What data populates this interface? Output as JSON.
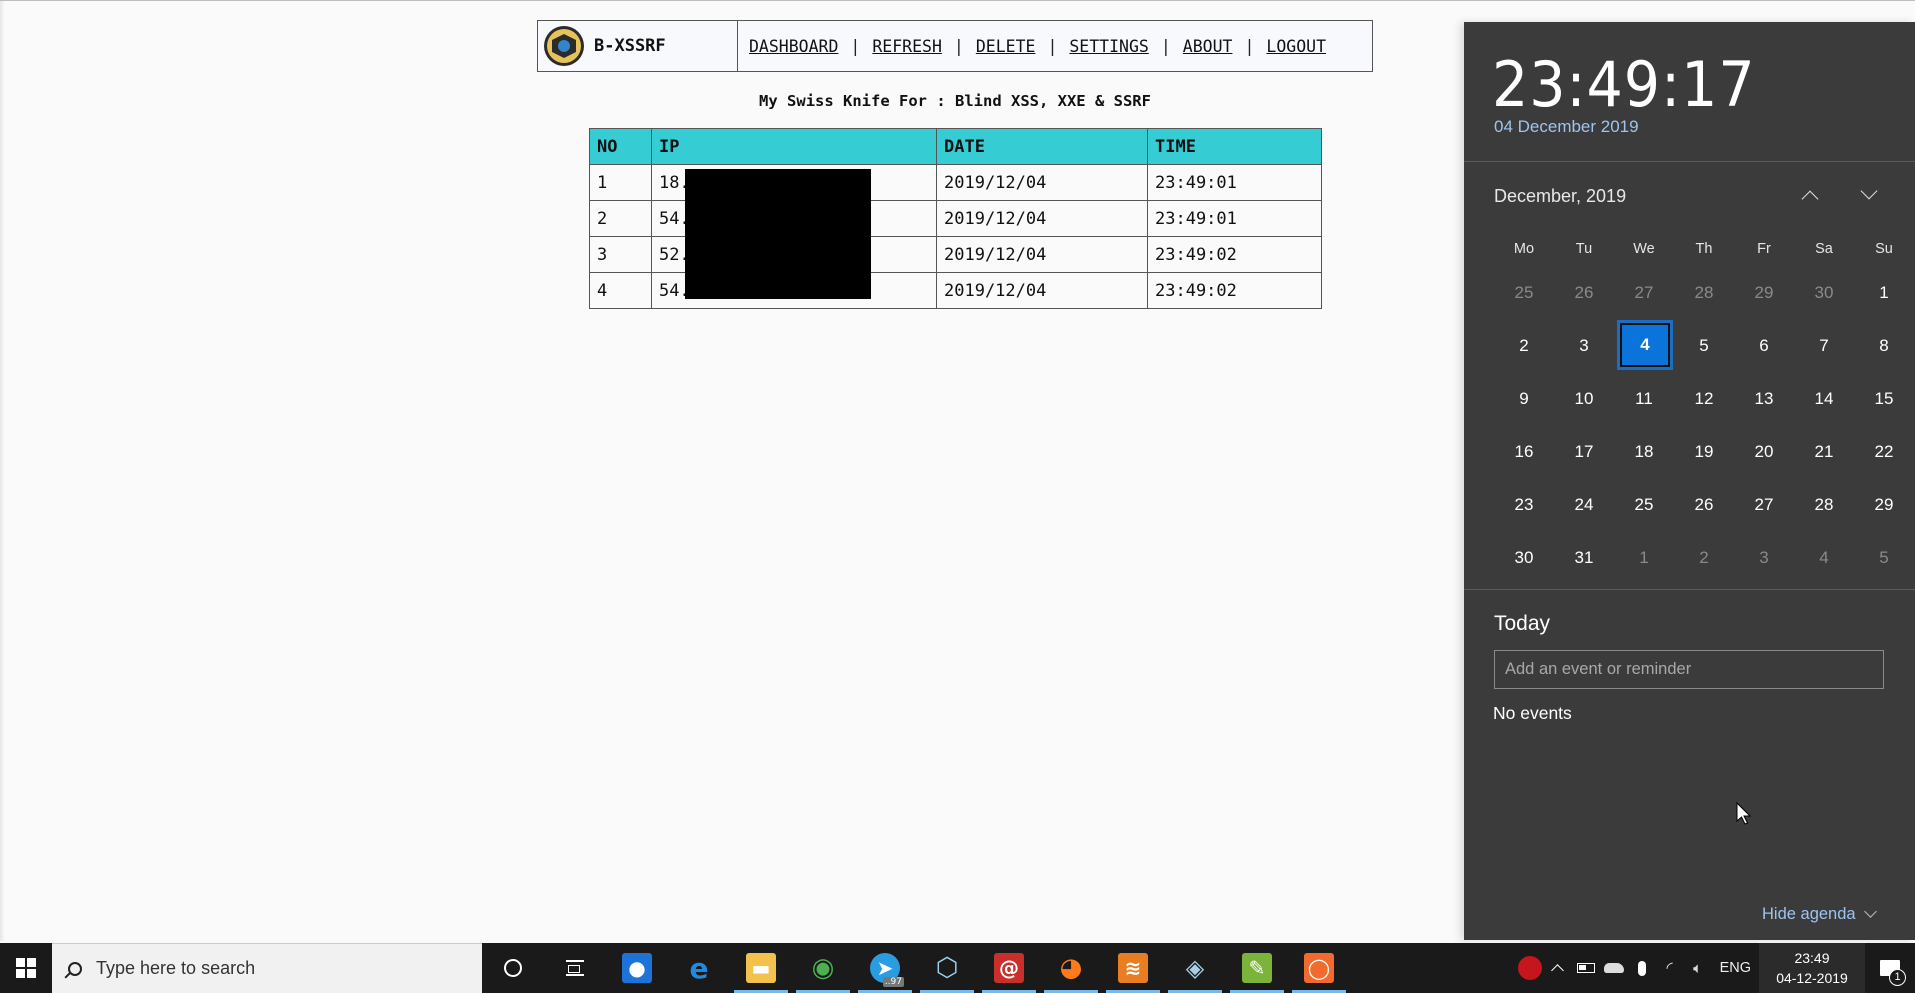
{
  "app": {
    "brand": "B-XSSRF",
    "nav": [
      "DASHBOARD",
      "REFRESH",
      "DELETE",
      "SETTINGS",
      "ABOUT",
      "LOGOUT"
    ],
    "nav_separator": "|",
    "tagline": "My Swiss Knife For : Blind XSS, XXE & SSRF",
    "table": {
      "columns": [
        "NO",
        "IP",
        "DATE",
        "TIME"
      ],
      "rows": [
        {
          "no": "1",
          "ip": "18.",
          "date": "2019/12/04",
          "time": "23:49:01"
        },
        {
          "no": "2",
          "ip": "54.",
          "date": "2019/12/04",
          "time": "23:49:01"
        },
        {
          "no": "3",
          "ip": "52.",
          "date": "2019/12/04",
          "time": "23:49:02"
        },
        {
          "no": "4",
          "ip": "54.",
          "date": "2019/12/04",
          "time": "23:49:02"
        }
      ],
      "header_color": "#35cdd3",
      "ip_redacted": true
    }
  },
  "calendar": {
    "time": "23:49:17",
    "long_date": "04 December 2019",
    "month_label": "December, 2019",
    "weekdays": [
      "Mo",
      "Tu",
      "We",
      "Th",
      "Fr",
      "Sa",
      "Su"
    ],
    "days": [
      {
        "d": "25",
        "dim": true
      },
      {
        "d": "26",
        "dim": true
      },
      {
        "d": "27",
        "dim": true
      },
      {
        "d": "28",
        "dim": true
      },
      {
        "d": "29",
        "dim": true
      },
      {
        "d": "30",
        "dim": true
      },
      {
        "d": "1"
      },
      {
        "d": "2"
      },
      {
        "d": "3"
      },
      {
        "d": "4",
        "today": true
      },
      {
        "d": "5"
      },
      {
        "d": "6"
      },
      {
        "d": "7"
      },
      {
        "d": "8"
      },
      {
        "d": "9"
      },
      {
        "d": "10"
      },
      {
        "d": "11"
      },
      {
        "d": "12"
      },
      {
        "d": "13"
      },
      {
        "d": "14"
      },
      {
        "d": "15"
      },
      {
        "d": "16"
      },
      {
        "d": "17"
      },
      {
        "d": "18"
      },
      {
        "d": "19"
      },
      {
        "d": "20"
      },
      {
        "d": "21"
      },
      {
        "d": "22"
      },
      {
        "d": "23"
      },
      {
        "d": "24"
      },
      {
        "d": "25"
      },
      {
        "d": "26"
      },
      {
        "d": "27"
      },
      {
        "d": "28"
      },
      {
        "d": "29"
      },
      {
        "d": "30"
      },
      {
        "d": "31"
      },
      {
        "d": "1",
        "dim": true
      },
      {
        "d": "2",
        "dim": true
      },
      {
        "d": "3",
        "dim": true
      },
      {
        "d": "4",
        "dim": true
      },
      {
        "d": "5",
        "dim": true
      }
    ],
    "agenda_title": "Today",
    "event_placeholder": "Add an event or reminder",
    "no_events": "No events",
    "hide_agenda": "Hide agenda",
    "accent": "#0a74da"
  },
  "taskbar": {
    "search_placeholder": "Type here to search",
    "pinned": [
      {
        "name": "bug-app",
        "color": "#1e73d8",
        "glyph": "●",
        "running": false
      },
      {
        "name": "edge",
        "color": "#1a1a1a",
        "glyph": "e",
        "running": false
      },
      {
        "name": "file-explorer",
        "color": "#f3c24d",
        "glyph": "▬",
        "running": true
      },
      {
        "name": "chrome",
        "color": "#1a1a1a",
        "glyph": "◉",
        "running": true
      },
      {
        "name": "telegram",
        "color": "#2a9de0",
        "glyph": "➤",
        "running": true,
        "badge": "..97"
      },
      {
        "name": "virtualbox",
        "color": "#1a1a1a",
        "glyph": "⬡",
        "running": true
      },
      {
        "name": "debian-64",
        "color": "#c9302c",
        "glyph": "@",
        "running": true
      },
      {
        "name": "firefox",
        "color": "#1a1a1a",
        "glyph": "◕",
        "running": true
      },
      {
        "name": "sublime-text",
        "color": "#e87d22",
        "glyph": "≋",
        "running": true
      },
      {
        "name": "vpn-eye",
        "color": "#1a1a1a",
        "glyph": "◈",
        "running": true
      },
      {
        "name": "notepad-plus",
        "color": "#7bb33b",
        "glyph": "✎",
        "running": true
      },
      {
        "name": "screen-recorder",
        "color": "#f26a2e",
        "glyph": "◯",
        "running": true
      }
    ],
    "tray": {
      "language": "ENG",
      "time": "23:49",
      "date": "04-12-2019",
      "notification_count": "1"
    }
  }
}
